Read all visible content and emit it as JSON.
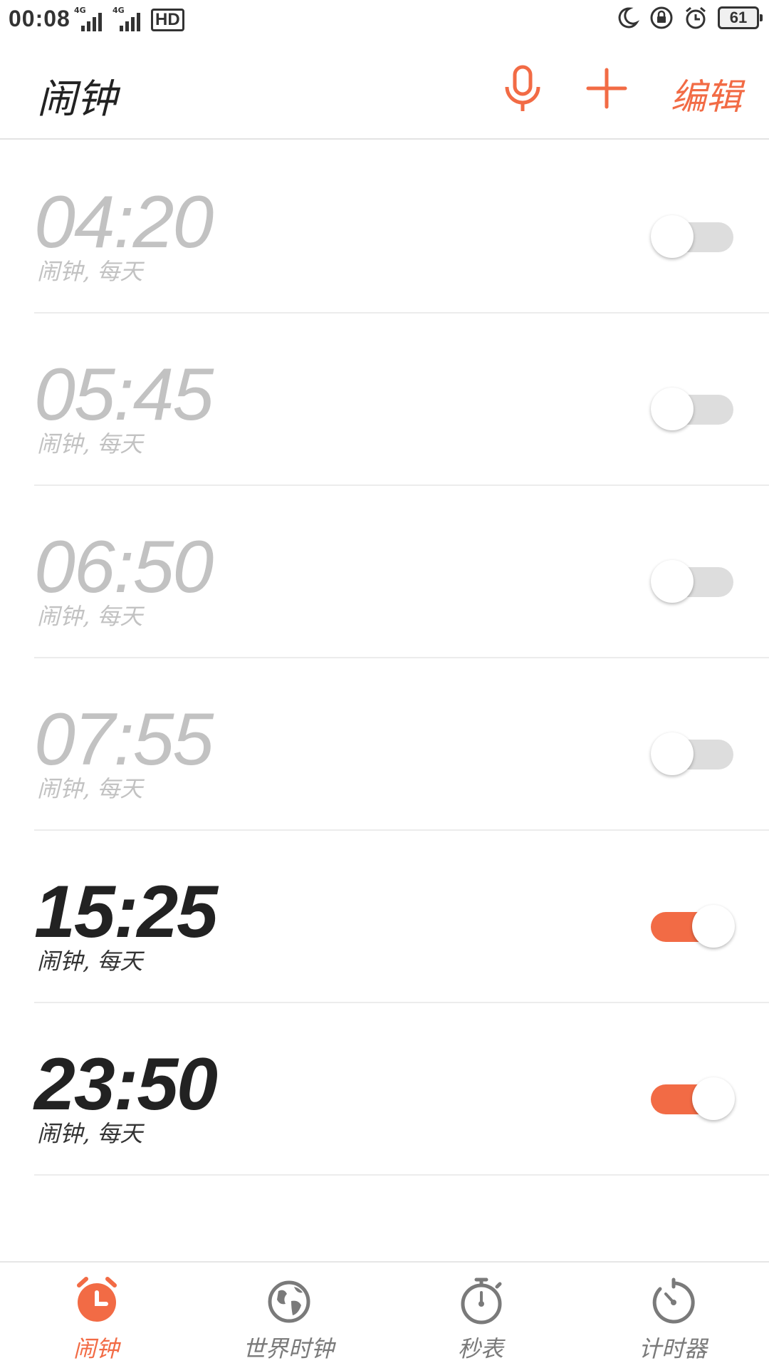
{
  "status_bar": {
    "time": "00:08",
    "signal1_label": "4G",
    "signal2_label": "4G",
    "hd_label": "HD",
    "battery_level": "61",
    "icons": [
      "moon-icon",
      "rotation-lock-icon",
      "alarm-clock-icon"
    ]
  },
  "header": {
    "title": "闹钟",
    "edit_label": "编辑",
    "mic_icon": "microphone-icon",
    "add_icon": "plus-icon"
  },
  "alarms": [
    {
      "time": "04:20",
      "subtitle": "闹钟, 每天",
      "enabled": false
    },
    {
      "time": "05:45",
      "subtitle": "闹钟, 每天",
      "enabled": false
    },
    {
      "time": "06:50",
      "subtitle": "闹钟, 每天",
      "enabled": false
    },
    {
      "time": "07:55",
      "subtitle": "闹钟, 每天",
      "enabled": false
    },
    {
      "time": "15:25",
      "subtitle": "闹钟, 每天",
      "enabled": true
    },
    {
      "time": "23:50",
      "subtitle": "闹钟, 每天",
      "enabled": true
    }
  ],
  "tabs": [
    {
      "label": "闹钟",
      "icon": "alarm-clock-icon",
      "active": true
    },
    {
      "label": "世界时钟",
      "icon": "globe-icon",
      "active": false
    },
    {
      "label": "秒表",
      "icon": "stopwatch-icon",
      "active": false
    },
    {
      "label": "计时器",
      "icon": "timer-icon",
      "active": false
    }
  ],
  "colors": {
    "accent": "#f26b45",
    "toggle_off_track": "#dddddd",
    "disabled_text": "#c2c2c2",
    "inactive_icon": "#7a7a7a"
  }
}
